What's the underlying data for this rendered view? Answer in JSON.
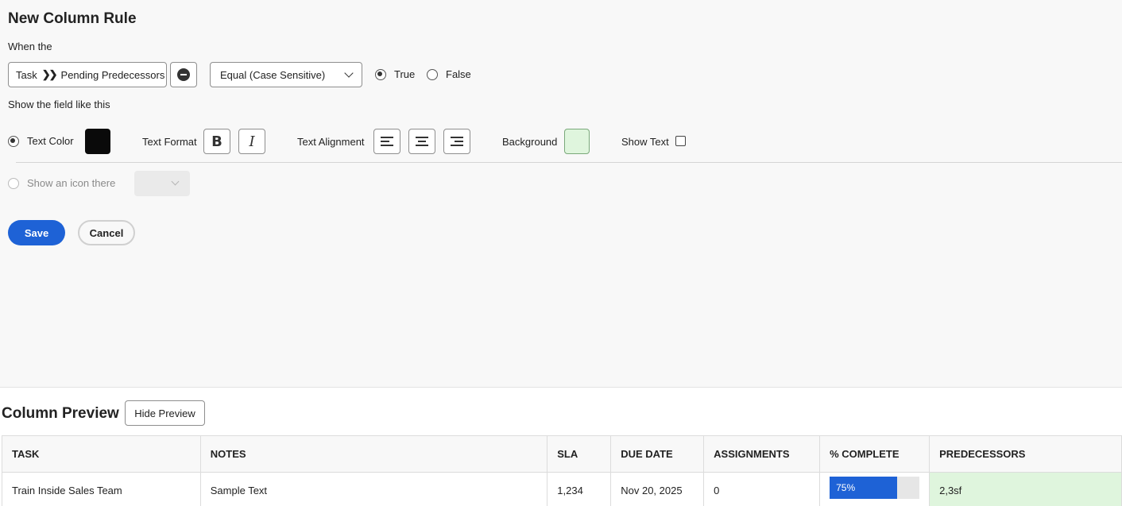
{
  "rule": {
    "title": "New Column Rule",
    "when_label": "When the",
    "field_object": "Task",
    "field_name": "Pending Predecessors",
    "operator": "Equal (Case Sensitive)",
    "value_true_label": "True",
    "value_false_label": "False",
    "value_selected": "True",
    "show_label": "Show the field like this",
    "text_color_label": "Text Color",
    "text_color": "#0a0a0a",
    "text_format_label": "Text Format",
    "bold_label": "B",
    "italic_label": "I",
    "text_alignment_label": "Text Alignment",
    "background_label": "Background",
    "background_color": "#dff5dd",
    "show_text_label": "Show Text",
    "show_icon_label": "Show an icon there",
    "save_label": "Save",
    "cancel_label": "Cancel"
  },
  "preview": {
    "title": "Column Preview",
    "hide_label": "Hide Preview",
    "columns": [
      "TASK",
      "NOTES",
      "SLA",
      "DUE DATE",
      "ASSIGNMENTS",
      "% COMPLETE",
      "PREDECESSORS"
    ],
    "row": {
      "task": "Train Inside Sales Team",
      "notes": "Sample Text",
      "sla": "1,234",
      "due_date": "Nov 20, 2025",
      "assignments": "0",
      "percent_complete": "75%",
      "percent_value": 75,
      "predecessors": "2,3sf"
    }
  },
  "colors": {
    "accent": "#1e62d6",
    "highlight": "#dff5dd"
  }
}
